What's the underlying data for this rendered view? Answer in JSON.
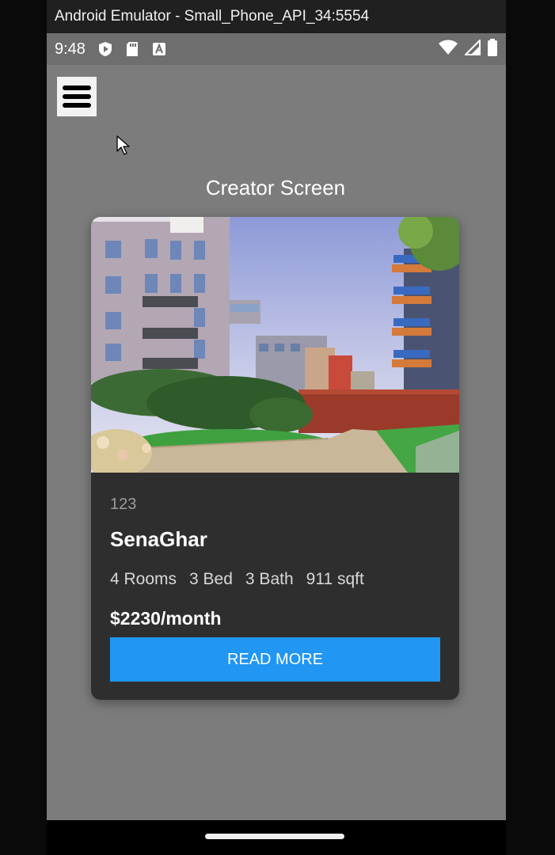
{
  "window": {
    "title": "Android Emulator - Small_Phone_API_34:5554"
  },
  "status_bar": {
    "time": "9:48",
    "left_icons": [
      "play-protect-icon",
      "sd-card-icon",
      "a-notification-icon"
    ],
    "right_icons": [
      "wifi-icon",
      "signal-icon",
      "battery-icon"
    ]
  },
  "app": {
    "menu_icon": "hamburger-menu-icon",
    "screen_title": "Creator Screen"
  },
  "card": {
    "id": "123",
    "name": "SenaGhar",
    "features": [
      "4 Rooms",
      "3 Bed",
      "3 Bath",
      "911 sqft"
    ],
    "price": "$2230/month",
    "button_label": "READ MORE"
  },
  "colors": {
    "screen_bg": "#7c7c7c",
    "card_bg": "#2e2e2e",
    "button": "#2196f3"
  }
}
